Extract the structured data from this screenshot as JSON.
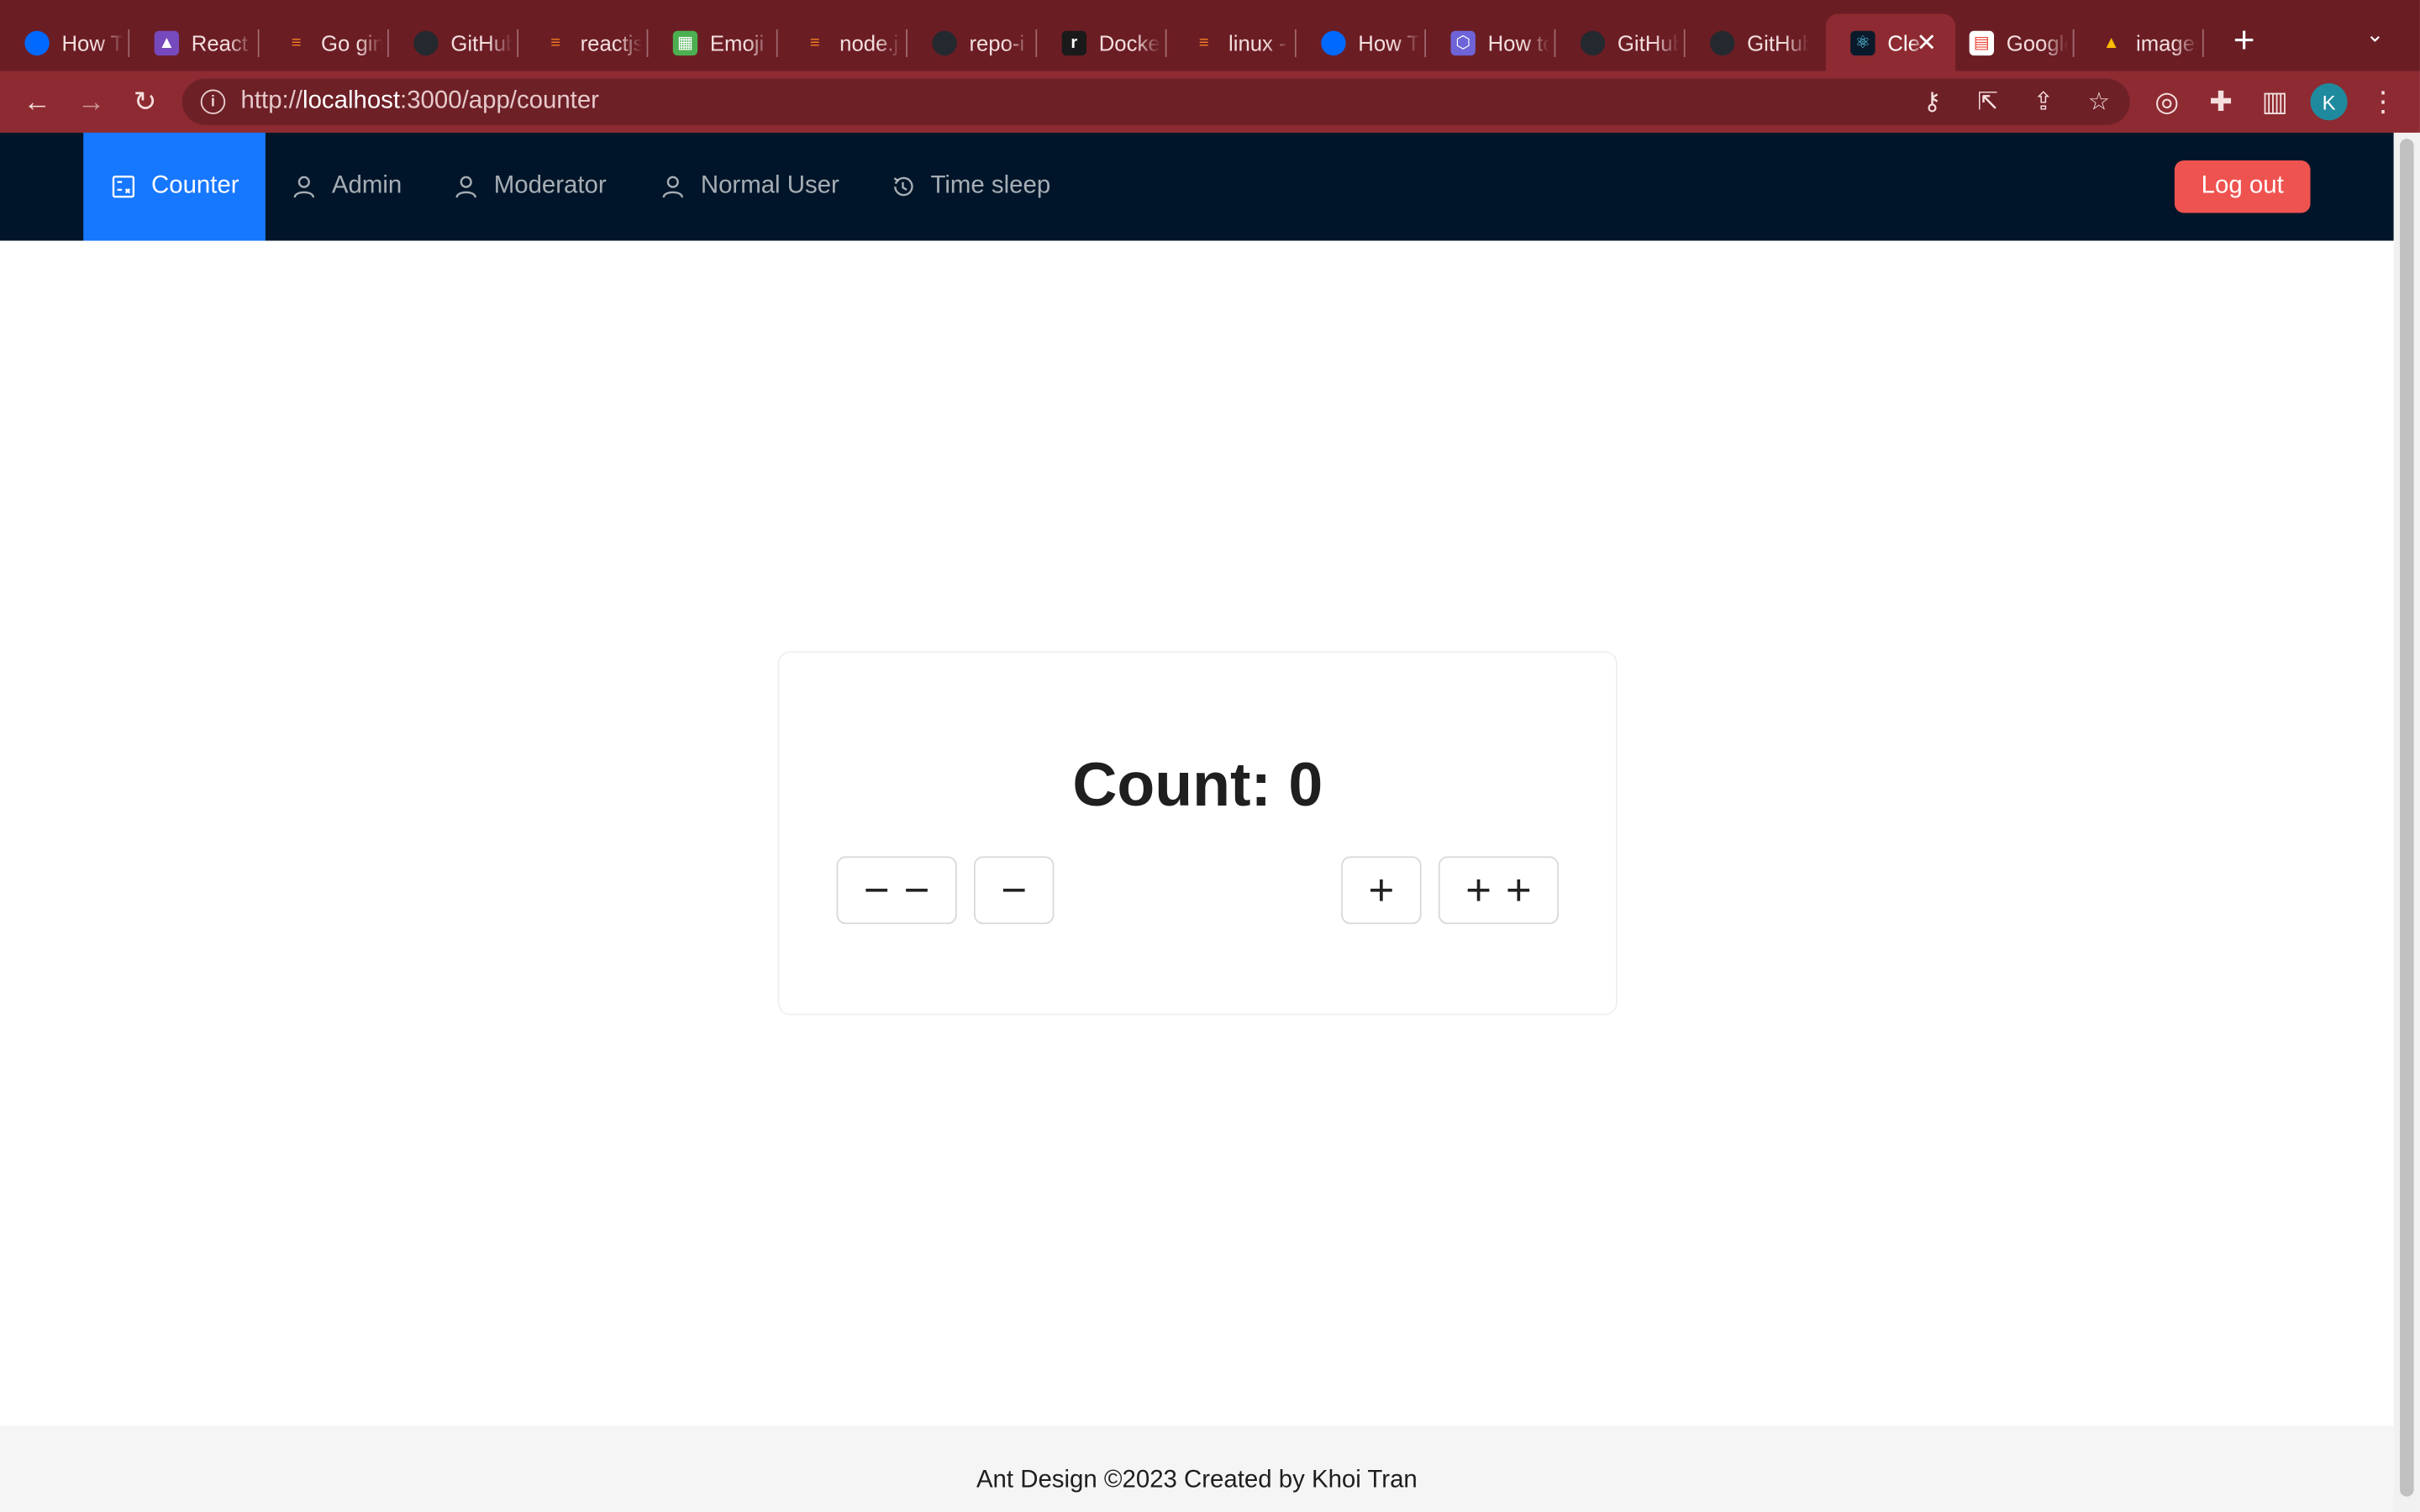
{
  "browser": {
    "tabs": [
      {
        "title": "How To",
        "icon": "digitalocean-icon",
        "color": "#0069ff"
      },
      {
        "title": "React",
        "icon": "rocket-icon",
        "color": "#764abc"
      },
      {
        "title": "Go gin",
        "icon": "stackoverflow-icon",
        "color": "#f48024"
      },
      {
        "title": "GitHub",
        "icon": "github-icon",
        "color": "#24292f"
      },
      {
        "title": "reactjs",
        "icon": "stackoverflow-icon",
        "color": "#f48024"
      },
      {
        "title": "Emoji",
        "icon": "emoji-icon",
        "color": "#4caf50"
      },
      {
        "title": "node.js",
        "icon": "stackoverflow-icon",
        "color": "#f48024"
      },
      {
        "title": "repo-i",
        "icon": "github-icon",
        "color": "#24292f"
      },
      {
        "title": "Docker",
        "icon": "docker-r-icon",
        "color": "#1a1a1a"
      },
      {
        "title": "linux -",
        "icon": "stackoverflow-icon",
        "color": "#f48024"
      },
      {
        "title": "How To",
        "icon": "digitalocean-icon",
        "color": "#0069ff"
      },
      {
        "title": "How to",
        "icon": "hexagon-icon",
        "color": "#6f63d8"
      },
      {
        "title": "GitHub",
        "icon": "github-icon",
        "color": "#24292f"
      },
      {
        "title": "GitHub",
        "icon": "github-icon",
        "color": "#24292f"
      },
      {
        "title": "Cle",
        "icon": "react-icon",
        "color": "#0b1a2b",
        "active": true
      },
      {
        "title": "Google",
        "icon": "google-icon",
        "color": "#ffffff"
      },
      {
        "title": "images",
        "icon": "google-drive-icon",
        "color": "#1fa463"
      }
    ],
    "url_scheme": "http://",
    "url_host": "localhost",
    "url_path": ":3000/app/counter",
    "profile_initial": "K"
  },
  "nav": {
    "items": [
      {
        "label": "Counter",
        "icon": "calculator-icon",
        "selected": true
      },
      {
        "label": "Admin",
        "icon": "user-icon"
      },
      {
        "label": "Moderator",
        "icon": "user-icon"
      },
      {
        "label": "Normal User",
        "icon": "user-icon"
      },
      {
        "label": "Time sleep",
        "icon": "history-icon"
      }
    ],
    "logout_label": "Log out"
  },
  "counter": {
    "label": "Count: 0",
    "value": 0
  },
  "footer": {
    "text": "Ant Design ©2023 Created by Khoi Tran"
  },
  "colors": {
    "tabstrip": "#6b1d24",
    "toolbar": "#8e2a31",
    "nav_bg": "#001529",
    "nav_selected": "#1677ff",
    "logout": "#ef5350"
  }
}
